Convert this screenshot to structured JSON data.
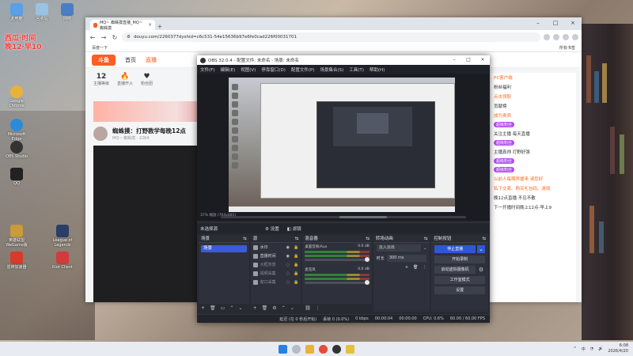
{
  "desktop": {
    "overlay_text": [
      "西瓜·时间",
      "晚12·早10"
    ],
    "icons": [
      {
        "label": "此电脑",
        "color": "#5aa0e6"
      },
      {
        "label": "回收站",
        "color": "#9bc2e2"
      },
      {
        "label": "网络",
        "color": "#4a7ec4"
      },
      {
        "label": "Google Chrome",
        "color": "#e8b23a"
      },
      {
        "label": "Microsoft Edge",
        "color": "#2d8ad8"
      },
      {
        "label": "OBS Studio",
        "color": "#333333"
      },
      {
        "label": "QQ",
        "color": "#222222"
      },
      {
        "label": "英雄联盟WeGame版",
        "color": "#c99b3a"
      },
      {
        "label": "League of Legends",
        "color": "#2a3e68"
      },
      {
        "label": "雷神加速器",
        "color": "#d73a2a"
      },
      {
        "label": "Riot Client",
        "color": "#d33a3a"
      }
    ]
  },
  "browser": {
    "tab_title": "MQ~ 蜘蛛摸直播_MQ~ 蜘蛛摸",
    "url": "douyu.com/2260377dyshid=c6c531-54e15636b97e6fe0cad226f00031701",
    "bookmark_left": "百度一下",
    "bookmark_right": "所有书签",
    "site": {
      "logo": "斗鱼",
      "nav": [
        "首页",
        "直播"
      ],
      "stats": [
        {
          "value": "12",
          "label": "主播等级"
        },
        {
          "value": "",
          "label": "直播开火"
        },
        {
          "value": "",
          "label": "粉丝团"
        }
      ],
      "room_title": "蜘蛛摸：打野教学每晚12点",
      "room_sub": "MQ~ 蜘蛛摸",
      "room_heat": "2264",
      "chat_lines": [
        {
          "text": "PC客户端",
          "style": "or"
        },
        {
          "text": "粉丝福利",
          "style": ""
        },
        {
          "text": "点击领取",
          "style": "or"
        },
        {
          "text": "贡献榜",
          "style": ""
        },
        {
          "text": "成为贵宾",
          "style": "or"
        },
        {
          "text": "关注主播 每天直播",
          "style": ""
        },
        {
          "text": "主播真帅 打野好强",
          "style": ""
        },
        {
          "text": "以前人每期声援来 请您好",
          "style": "or"
        },
        {
          "text": "私下交易、购买礼包码、游戏",
          "style": "or"
        },
        {
          "text": "晚12点直播 不见不散",
          "style": ""
        },
        {
          "text": "下一开播时间晚上12点-早上9",
          "style": ""
        }
      ],
      "badges": [
        "超级粉丝",
        "超级粉丝",
        "超级粉丝",
        "超级粉丝"
      ]
    }
  },
  "obs": {
    "title": "OBS 32.0.4 - 配置文件: 未命名 - 场景: 未命名",
    "menu": [
      "文件(F)",
      "编辑(E)",
      "视图(V)",
      "停靠窗口(D)",
      "配置文件(P)",
      "场景集合(S)",
      "工具(T)",
      "帮助(H)"
    ],
    "zoom_text": "37%",
    "scale_text": "缩放 (704x481)",
    "source_bar": {
      "no_source": "未选择源",
      "props": "设置",
      "filters": "滤镜"
    },
    "docks": {
      "scenes": {
        "title": "场景",
        "items": [
          "场景"
        ]
      },
      "sources": {
        "title": "源",
        "items": [
          {
            "label": "水印",
            "dim": false
          },
          {
            "label": "直播时间",
            "dim": false
          },
          {
            "label": "大框背景",
            "dim": true
          },
          {
            "label": "视频采集",
            "dim": true
          },
          {
            "label": "窗口采集",
            "dim": true
          }
        ]
      },
      "mixer": {
        "title": "混音器",
        "channels": [
          {
            "name": "桌面音频/Aux",
            "db": "0.0 dB"
          },
          {
            "name": "麦克风",
            "db": "0.0 dB"
          }
        ]
      },
      "transitions": {
        "title": "转场动画",
        "selected": "淡入淡出",
        "duration_label": "时长",
        "duration": "300 ms"
      },
      "controls": {
        "title": "控制按钮",
        "buttons": [
          "停止直播",
          "开始录制",
          "启动虚拟摄像机",
          "工作室模式",
          "设置"
        ]
      }
    },
    "status": {
      "dropped": "延迟 (在 0 秒后开始)",
      "frames": "丢帧 0 (0.0%)",
      "bitrate": "0 kbps",
      "rec_time": "00:00:04",
      "time": "00:00:00",
      "cpu": "CPU: 0.6%",
      "fps": "60.00 / 60.00 FPS"
    }
  },
  "taskbar": {
    "icons": [
      {
        "name": "start",
        "color": "#2a7fe0"
      },
      {
        "name": "search",
        "color": "#999999"
      },
      {
        "name": "file-explorer",
        "color": "#e8b33a"
      },
      {
        "name": "chrome",
        "color": "#e34b3a"
      },
      {
        "name": "obs",
        "color": "#333333"
      },
      {
        "name": "app",
        "color": "#e3c040"
      }
    ],
    "time": "6:08",
    "date": "2026/4/20",
    "lang": "中"
  }
}
